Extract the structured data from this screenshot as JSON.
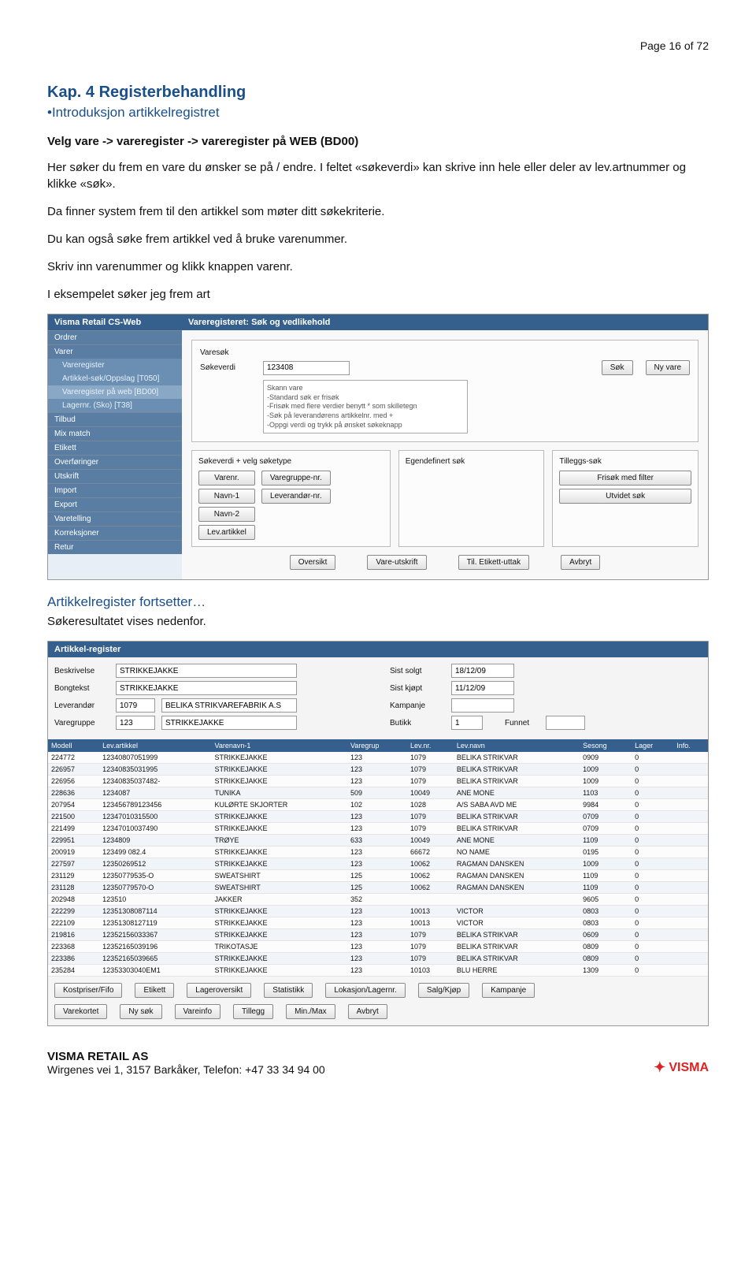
{
  "page_header": "Page 16 of 72",
  "chapter_title": "Kap. 4 Registerbehandling",
  "sub_bullet": "•Introduksjon artikkelregistret",
  "line_bold": "Velg vare -> vareregister -> vareregister på WEB (BD00)",
  "p1": "Her søker du frem en vare du ønsker se på / endre. I feltet «søkeverdi» kan skrive inn hele eller deler av lev.artnummer og klikke «søk».",
  "p2": "Da finner system frem til den artikkel som møter ditt søkekriterie.",
  "p3": "Du kan også søke frem artikkel ved å bruke varenummer.",
  "p4": "Skriv inn varenummer og klikk knappen varenr.",
  "p5": "I eksempelet søker jeg frem art",
  "continue_title": "Artikkelregister fortsetter…",
  "continue_text": "Søkeresultatet vises nedenfor.",
  "ss1": {
    "app_title": "Visma Retail CS-Web",
    "nav_sections": [
      "Ordrer",
      "Varer"
    ],
    "nav_items": [
      "Vareregister",
      "Artikkel-søk/Oppslag [T050]",
      "Vareregister på web [BD00]",
      "Lagernr. (Sko) [T38]"
    ],
    "nav_tail": [
      "Tilbud",
      "Mix match",
      "Etikett",
      "Overføringer",
      "Utskrift",
      "Import",
      "Export",
      "Varetelling",
      "Korreksjoner",
      "Retur"
    ],
    "panel_title": "Vareregisteret: Søk og vedlikehold",
    "inner_label": "Varesøk",
    "search_label": "Søkeverdi",
    "search_value": "123408",
    "btn_search": "Søk",
    "btn_new": "Ny vare",
    "hint_lines": [
      "Skann vare",
      "-Standard søk er frisøk",
      "-Frisøk med flere verdier benytt * som skilletegn",
      "-Søk på leverandørens artikkelnr. med +",
      "-Oppgi verdi og trykk på ønsket søkeknapp"
    ],
    "colA_label": "Søkeverdi + velg søketype",
    "colA_btns": [
      "Varenr.",
      "Navn-1",
      "Navn-2",
      "Lev.artikkel"
    ],
    "colA_btns2": [
      "Varegruppe-nr.",
      "Leverandør-nr."
    ],
    "colB_label": "Egendefinert søk",
    "colC_label": "Tilleggs-søk",
    "colC_btns": [
      "Frisøk med filter",
      "Utvidet søk"
    ],
    "bottom_btns": [
      "Oversikt",
      "Vare-utskrift",
      "Til. Etikett-uttak",
      "Avbryt"
    ]
  },
  "ss2": {
    "panel_title": "Artikkel-register",
    "fields": {
      "Beskrivelse": "STRIKKEJAKKE",
      "Bongtekst": "STRIKKEJAKKE",
      "Leverandør_code": "1079",
      "Leverandør_name": "BELIKA STRIKVAREFABRIK A.S",
      "Varegruppe_code": "123",
      "Varegruppe_name": "STRIKKEJAKKE",
      "Sist_solgt": "18/12/09",
      "Sist_kjøpt": "11/12/09",
      "Kampanje": "",
      "Butikk": "1",
      "Funnet": ""
    },
    "labels": {
      "Beskrivelse": "Beskrivelse",
      "Bongtekst": "Bongtekst",
      "Leverandør": "Leverandør",
      "Varegruppe": "Varegruppe",
      "Sist_solgt": "Sist solgt",
      "Sist_kjøpt": "Sist kjøpt",
      "Kampanje": "Kampanje",
      "Butikk": "Butikk",
      "Funnet": "Funnet"
    },
    "headers": [
      "Modell",
      "Lev.artikkel",
      "Varenavn-1",
      "Varegrup",
      "Lev.nr.",
      "Lev.navn",
      "Sesong",
      "Lager",
      "Info."
    ],
    "rows": [
      [
        "224772",
        "12340807051999",
        "STRIKKEJAKKE",
        "123",
        "1079",
        "BELIKA STRIKVAR",
        "0909",
        "0",
        ""
      ],
      [
        "226957",
        "12340835031995",
        "STRIKKEJAKKE",
        "123",
        "1079",
        "BELIKA STRIKVAR",
        "1009",
        "0",
        ""
      ],
      [
        "226956",
        "12340835037482-",
        "STRIKKEJAKKE",
        "123",
        "1079",
        "BELIKA STRIKVAR",
        "1009",
        "0",
        ""
      ],
      [
        "228636",
        "1234087",
        "TUNIKA",
        "509",
        "10049",
        "ANE MONE",
        "1103",
        "0",
        ""
      ],
      [
        "207954",
        "123456789123456",
        "KULØRTE SKJORTER",
        "102",
        "1028",
        "A/S SABA AVD ME",
        "9984",
        "0",
        ""
      ],
      [
        "221500",
        "12347010315500",
        "STRIKKEJAKKE",
        "123",
        "1079",
        "BELIKA STRIKVAR",
        "0709",
        "0",
        ""
      ],
      [
        "221499",
        "12347010037490",
        "STRIKKEJAKKE",
        "123",
        "1079",
        "BELIKA STRIKVAR",
        "0709",
        "0",
        ""
      ],
      [
        "229951",
        "1234809",
        "TRØYE",
        "633",
        "10049",
        "ANE MONE",
        "1109",
        "0",
        ""
      ],
      [
        "200919",
        "123499  082.4",
        "STRIKKEJAKKE",
        "123",
        "66672",
        "NO NAME",
        "0195",
        "0",
        ""
      ],
      [
        "227597",
        "12350269512",
        "STRIKKEJAKKE",
        "123",
        "10062",
        "RAGMAN DANSKEN",
        "1009",
        "0",
        ""
      ],
      [
        "231129",
        "12350779535-O",
        "SWEATSHIRT",
        "125",
        "10062",
        "RAGMAN DANSKEN",
        "1109",
        "0",
        ""
      ],
      [
        "231128",
        "12350779570-O",
        "SWEATSHIRT",
        "125",
        "10062",
        "RAGMAN DANSKEN",
        "1109",
        "0",
        ""
      ],
      [
        "202948",
        "123510",
        "JAKKER",
        "352",
        "",
        "",
        "9605",
        "0",
        ""
      ],
      [
        "222299",
        "12351308087114",
        "STRIKKEJAKKE",
        "123",
        "10013",
        "VICTOR",
        "0803",
        "0",
        ""
      ],
      [
        "222109",
        "12351308127119",
        "STRIKKEJAKKE",
        "123",
        "10013",
        "VICTOR",
        "0803",
        "0",
        ""
      ],
      [
        "219816",
        "12352156033367",
        "STRIKKEJAKKE",
        "123",
        "1079",
        "BELIKA STRIKVAR",
        "0609",
        "0",
        ""
      ],
      [
        "223368",
        "12352165039196",
        "TRIKOTASJE",
        "123",
        "1079",
        "BELIKA STRIKVAR",
        "0809",
        "0",
        ""
      ],
      [
        "223386",
        "12352165039665",
        "STRIKKEJAKKE",
        "123",
        "1079",
        "BELIKA STRIKVAR",
        "0809",
        "0",
        ""
      ],
      [
        "235284",
        "12353303040EM1",
        "STRIKKEJAKKE",
        "123",
        "10103",
        "BLU HERRE",
        "1309",
        "0",
        ""
      ]
    ],
    "btnbar1": [
      "Kostpriser/Fifo",
      "Etikett",
      "Lageroversikt",
      "Statistikk",
      "Lokasjon/Lagernr.",
      "Salg/Kjøp",
      "Kampanje"
    ],
    "btnbar2": [
      "Varekortet",
      "Ny søk",
      "Vareinfo",
      "Tillegg",
      "Min./Max",
      "Avbryt"
    ]
  },
  "footer": {
    "company": "VISMA RETAIL AS",
    "addr": "Wirgenes vei 1, 3157 Barkåker, Telefon: +47 33 34 94 00",
    "logo": "VISMA"
  }
}
